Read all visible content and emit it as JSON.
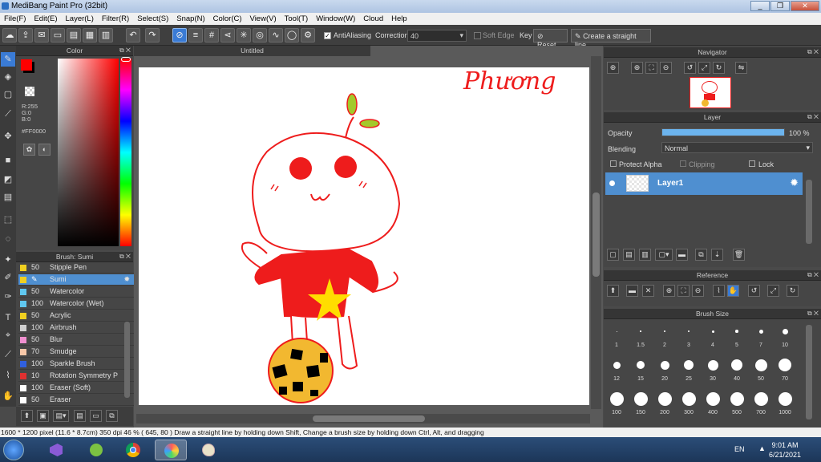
{
  "window": {
    "title": "MediBang Paint Pro (32bit)",
    "minimize": "_",
    "restore": "❐",
    "close": "✕"
  },
  "menu": [
    "File(F)",
    "Edit(E)",
    "Layer(L)",
    "Filter(R)",
    "Select(S)",
    "Snap(N)",
    "Color(C)",
    "View(V)",
    "Tool(T)",
    "Window(W)",
    "Cloud",
    "Help"
  ],
  "toolbar": {
    "antialiasing_label": "AntiAliasing",
    "antialiasing_checked": true,
    "correction_label": "Correction",
    "correction_value": "40",
    "soft_edge_label": "Soft Edge",
    "key_label": "Key",
    "reset_label": "Reset",
    "straight_line_label": "Create a straight line"
  },
  "color_panel": {
    "title": "Color",
    "r": "R:255",
    "g": "G:0",
    "b": "B:0",
    "hex": "#FF0000",
    "foreground": "#ff0000",
    "background": "#000000"
  },
  "canvas": {
    "tab_title": "Untitled",
    "signature": "Phương"
  },
  "brush_panel": {
    "title": "Brush: Sumi",
    "items": [
      {
        "size": "50",
        "name": "Stipple Pen",
        "color": "#f0d020"
      },
      {
        "size": "",
        "name": "Sumi",
        "color": "#f0d020",
        "selected": true
      },
      {
        "size": "50",
        "name": "Watercolor",
        "color": "#60c8f0"
      },
      {
        "size": "100",
        "name": "Watercolor (Wet)",
        "color": "#60c8f0"
      },
      {
        "size": "50",
        "name": "Acrylic",
        "color": "#f0d020"
      },
      {
        "size": "100",
        "name": "Airbrush",
        "color": "#d0d0d0"
      },
      {
        "size": "50",
        "name": "Blur",
        "color": "#f090d0"
      },
      {
        "size": "70",
        "name": "Smudge",
        "color": "#f8c8a8"
      },
      {
        "size": "100",
        "name": "Sparkle Brush",
        "color": "#3060e0"
      },
      {
        "size": "10",
        "name": "Rotation Symmetry P",
        "color": "#e03030"
      },
      {
        "size": "100",
        "name": "Eraser (Soft)",
        "color": "#ffffff"
      },
      {
        "size": "50",
        "name": "Eraser",
        "color": "#ffffff"
      }
    ]
  },
  "navigator": {
    "title": "Navigator"
  },
  "layer_panel": {
    "title": "Layer",
    "opacity_label": "Opacity",
    "opacity_value": "100 %",
    "opacity": 1.0,
    "blending_label": "Blending",
    "blending_value": "Normal",
    "protect_alpha": "Protect Alpha",
    "clipping": "Clipping",
    "lock": "Lock",
    "layers": [
      {
        "name": "Layer1",
        "selected": true
      }
    ]
  },
  "reference": {
    "title": "Reference"
  },
  "brush_size": {
    "title": "Brush Size",
    "sizes": [
      "1",
      "1.5",
      "2",
      "3",
      "4",
      "5",
      "7",
      "10",
      "12",
      "15",
      "20",
      "25",
      "30",
      "40",
      "50",
      "70",
      "100",
      "150",
      "200",
      "300",
      "400",
      "500",
      "700",
      "1000"
    ]
  },
  "status": {
    "text": "1600 * 1200 pixel   (11.6 * 8.7cm)   350 dpi   46 %   ( 645, 80 )   Draw a straight line by holding down Shift, Change a brush size by holding down Ctrl, Alt, and dragging"
  },
  "taskbar": {
    "language": "EN",
    "time": "9:01 AM",
    "date": "6/21/2021"
  }
}
